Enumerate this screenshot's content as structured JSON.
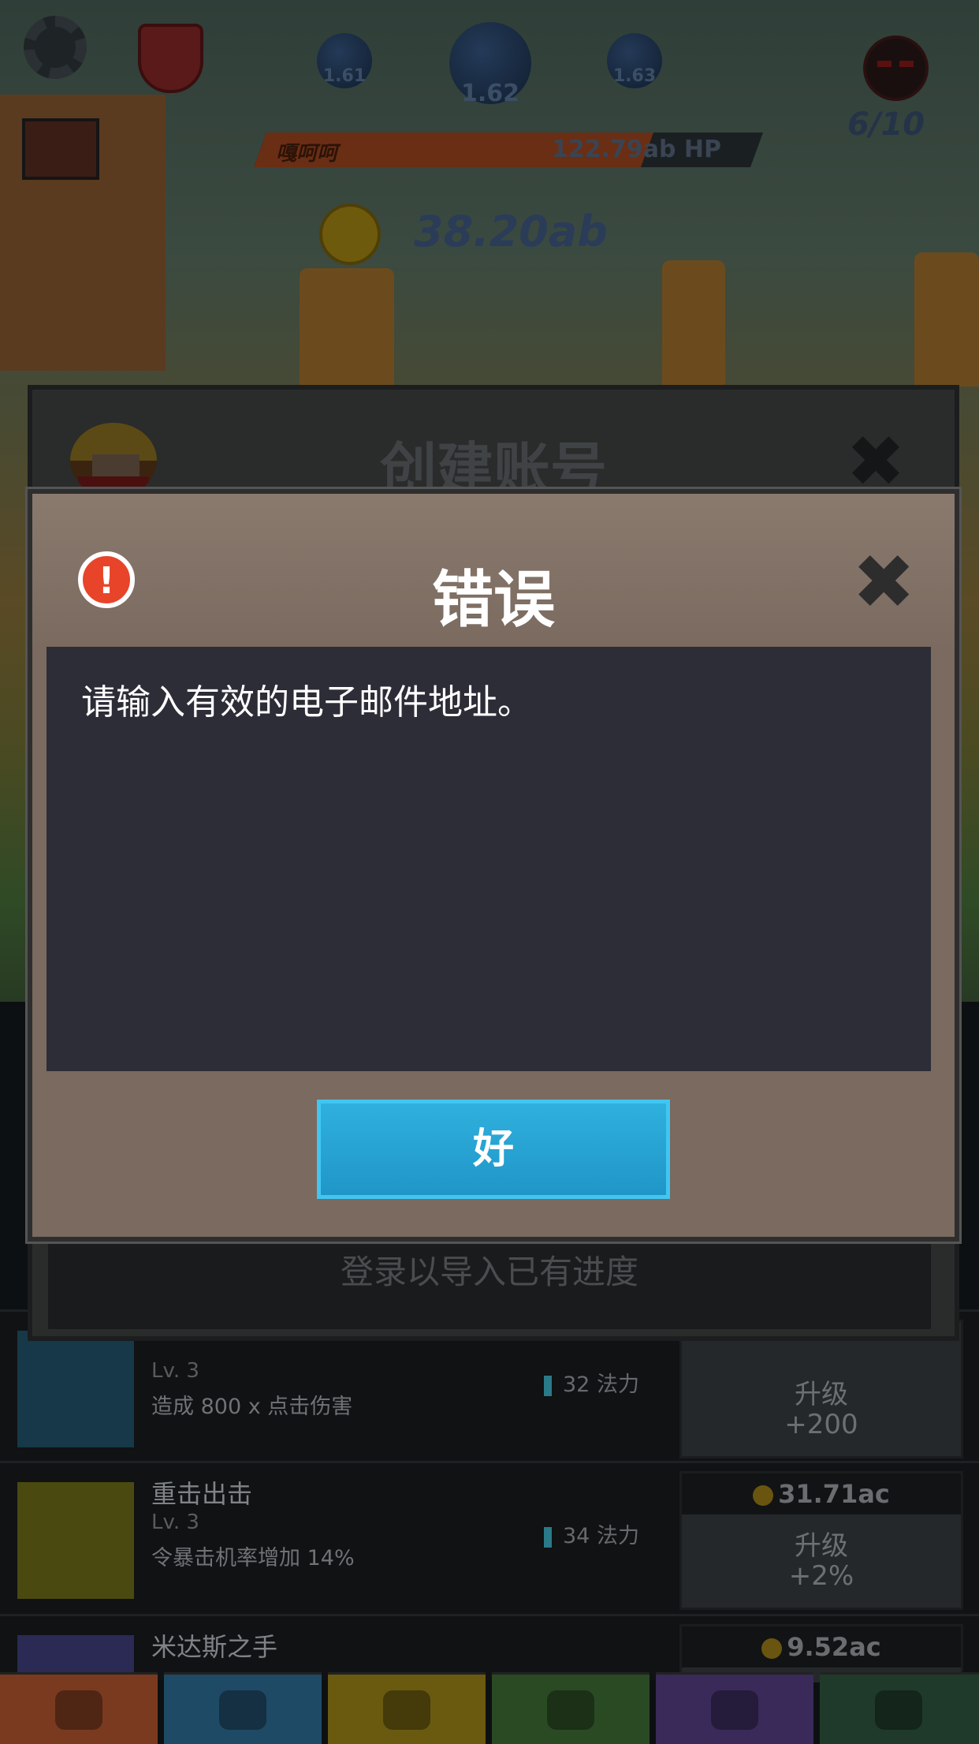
{
  "hud": {
    "stages": [
      "1.61",
      "1.62",
      "1.63"
    ],
    "stage_count": "6/10",
    "boss_name": "嘎呵呵",
    "boss_hp": "122.79ab HP",
    "boss_hp_fraction": 0.78,
    "gold": "38.20ab"
  },
  "create_account": {
    "title": "创建账号",
    "close": "✖",
    "progress_text": "登录以导入已有进度"
  },
  "error_dialog": {
    "title": "错误",
    "icon": "!",
    "close": "✖",
    "message": "请输入有效的电子邮件地址。",
    "ok_label": "好"
  },
  "skills": [
    {
      "name": "",
      "level": "Lv. 3",
      "desc": "造成 800 x 点击伤害",
      "cost": "32 法力",
      "price": "",
      "upgrade_label": "升级",
      "upgrade_value": "+200"
    },
    {
      "name": "重击出击",
      "level": "Lv. 3",
      "desc": "令暴击机率增加 14%",
      "cost": "34 法力",
      "price": "31.71ac",
      "upgrade_label": "升级",
      "upgrade_value": "+2%"
    },
    {
      "name": "米达斯之手",
      "level": "",
      "desc": "",
      "cost": "",
      "price": "9.52ac",
      "upgrade_label": "",
      "upgrade_value": ""
    }
  ],
  "tabs": [
    "sword-icon",
    "armor-icon",
    "shirt-icon",
    "helmet-icon",
    "cape-icon",
    "star-icon"
  ],
  "colors": {
    "ok_button": "#2aa6d6",
    "error_icon": "#e8442a",
    "dialog_frame": "#7a6a5f",
    "dialog_body": "#2d2d38"
  }
}
